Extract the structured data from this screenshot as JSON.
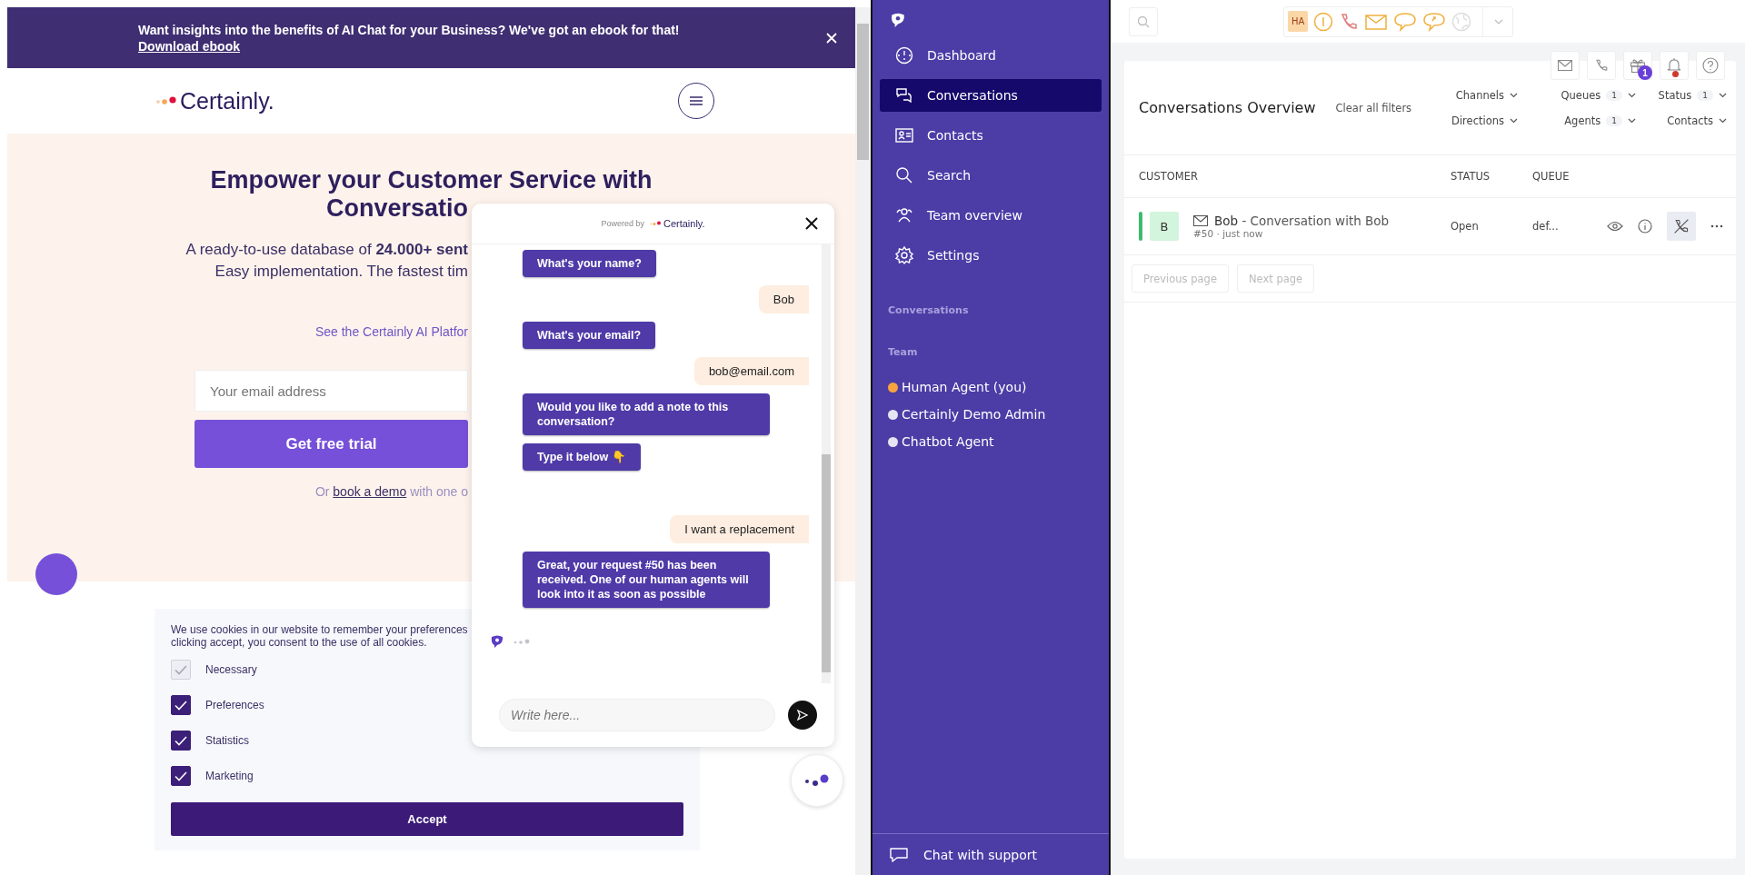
{
  "browser_page": {
    "banner": {
      "text": "Want insights into the benefits of AI Chat for your Business? We've got an ebook for that!",
      "link": "Download ebook"
    },
    "logo": "Certainly.",
    "hero": {
      "title_lines": [
        "Empower your Customer Service with",
        "Conversatio"
      ],
      "subtitle_lines": [
        "A ready-to-use database of **24.000+ sent**",
        "Easy implementation. The fastest tim"
      ],
      "platform_link": "See the Certainly AI Platfor",
      "email_placeholder": "Your email address",
      "cta": "Get free trial",
      "demo_prefix": "Or",
      "demo_link": "book a demo",
      "demo_suffix": "with one o"
    },
    "cookies": {
      "lines": [
        "We use cookies in our website to remember your preferences",
        "clicking accept, you consent to the use of all cookies."
      ],
      "options": [
        {
          "label": "Necessary",
          "checked": true,
          "disabled": true
        },
        {
          "label": "Preferences",
          "checked": true,
          "disabled": false
        },
        {
          "label": "Statistics",
          "checked": true,
          "disabled": false
        },
        {
          "label": "Marketing",
          "checked": true,
          "disabled": false
        }
      ],
      "accept": "Accept"
    }
  },
  "chat_widget": {
    "powered_by": "Powered by",
    "logo": "Certainly.",
    "messages": [
      {
        "kind": "bot",
        "text": "What's your name?"
      },
      {
        "kind": "user",
        "text": "Bob"
      },
      {
        "kind": "bot",
        "text": "What's your email?"
      },
      {
        "kind": "user",
        "text": "bob@email.com"
      },
      {
        "kind": "bot",
        "text": "Would you like to add a note to this conversation?"
      },
      {
        "kind": "bot",
        "text": "Type it below 👇"
      },
      {
        "kind": "user",
        "text": "I want a replacement"
      },
      {
        "kind": "bot",
        "text": "Great, your request #50 has been received. One of our human agents will look into it as soon as possible"
      }
    ],
    "typing": true,
    "input_placeholder": "Write here..."
  },
  "sidebar": {
    "items": [
      {
        "label": "Dashboard",
        "selected": false
      },
      {
        "label": "Conversations",
        "selected": true
      },
      {
        "label": "Contacts",
        "selected": false
      },
      {
        "label": "Search",
        "selected": false
      },
      {
        "label": "Team overview",
        "selected": false
      },
      {
        "label": "Settings",
        "selected": false
      }
    ],
    "conversations_heading": "Conversations",
    "team_heading": "Team",
    "members": [
      {
        "name": "Human Agent (you)",
        "color": "#f7a440"
      },
      {
        "name": "Certainly Demo Admin",
        "color": "#e4e4f2"
      },
      {
        "name": "Chatbot Agent",
        "color": "#e4e4f2"
      }
    ],
    "support": "Chat with support"
  },
  "topbar": {
    "agent_initials": "HA"
  },
  "overview": {
    "title": "Conversations Overview",
    "clear_filters": "Clear all filters",
    "gift_count": "1",
    "bell_alert": true,
    "filters": [
      {
        "label": "Channels"
      },
      {
        "label": "Queues",
        "count": "1"
      },
      {
        "label": "Status",
        "count": "1"
      },
      {
        "label": "Directions"
      },
      {
        "label": "Agents",
        "count": "1"
      },
      {
        "label": "Contacts"
      }
    ],
    "columns": [
      "CUSTOMER",
      "STATUS",
      "QUEUE"
    ],
    "rows": [
      {
        "initial": "B",
        "name": "Bob",
        "subject": "- Conversation with Bob",
        "meta": "#50 · just now",
        "status": "Open",
        "queue": "def...",
        "color": "#3dbb6f"
      }
    ],
    "pagination": [
      "Previous page",
      "Next page"
    ]
  }
}
